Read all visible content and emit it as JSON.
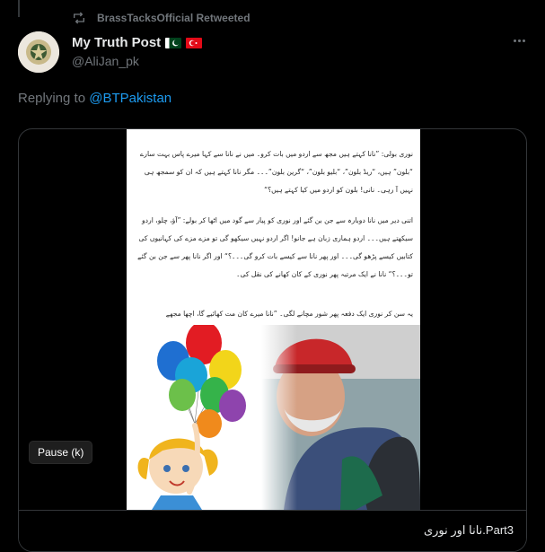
{
  "retweet": {
    "label": "BrassTacksOfficial Retweeted"
  },
  "author": {
    "name": "My Truth Post",
    "handle": "@AliJan_pk"
  },
  "reply": {
    "prefix": "Replying to ",
    "mention": "@BTPakistan"
  },
  "media": {
    "paragraphs": [
      "نوری بولی: ”نانا کہتے ہیں مجھ سے اردو میں بات کرو۔ میں نے نانا سے کہا میرے پاس بہت سارے “بلون” ہیں، “ریڈ بلون”، “بلیو بلون”، “گرین بلون”۔۔۔ مگر نانا کہتے ہیں کہ ان کو سمجھ ہی نہیں آ رہی۔ نانی! بلون کو اردو میں کیا کہتے ہیں؟“",
      "اتنی دیر میں نانا دوبارہ سے جن بن گئے اور نوری کو پیار سے گود میں اٹھا کر بولے: ”آؤ، چلو، اردو سیکھتے ہیں۔۔۔ اردو ہماری زبان ہے جانو! اگر اردو نہیں سیکھو گی تو مزے مزے کی کہانیوں کی کتابیں کیسے پڑھو گی۔۔۔ اور پھر نانا سے کیسے بات کرو گی۔۔۔؟“ اور اگر نانا پھر سے جن بن گئے تو۔۔۔؟“ نانا نے ایک مرتبہ پھر نوری کے کان کھانے کی نقل کی۔",
      "یہ سن کر نوری ایک دفعہ پھر شور مچانے لگی۔ ”نانا میرے کان مت کھائیے گا، اچھا مجھے سکھائیں۔۔۔“"
    ],
    "pause_label": "Pause (k)",
    "caption": "Part3.نانا اور نوری"
  },
  "colors": {
    "accent": "#1d9bf0",
    "muted": "#71767b",
    "text": "#e7e9ea",
    "border": "#333639"
  }
}
